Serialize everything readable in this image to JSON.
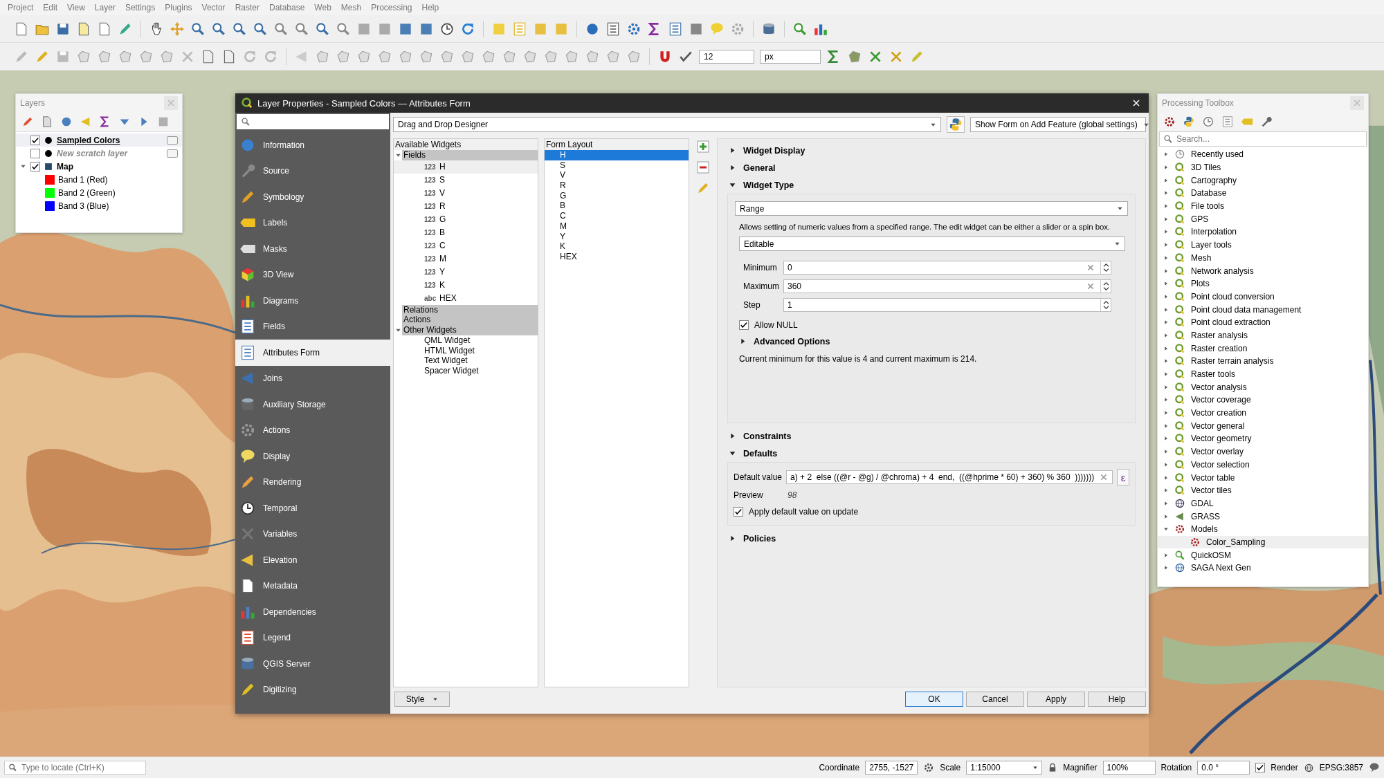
{
  "menu": [
    "Project",
    "Edit",
    "View",
    "Layer",
    "Settings",
    "Plugins",
    "Vector",
    "Raster",
    "Database",
    "Web",
    "Mesh",
    "Processing",
    "Help"
  ],
  "toolbar": {
    "size": "12",
    "unit": "px"
  },
  "layers_panel": {
    "title": "Layers",
    "layers": [
      {
        "name": "Sampled Colors",
        "kind": "vector",
        "checked": true,
        "selected": true
      },
      {
        "name": "New scratch layer",
        "kind": "scratch",
        "checked": false,
        "selected": false
      },
      {
        "name": "Map",
        "kind": "raster",
        "checked": true,
        "selected": false,
        "expanded": true,
        "children": [
          {
            "name": "Band 1 (Red)",
            "color": "#ff0000"
          },
          {
            "name": "Band 2 (Green)",
            "color": "#00ff00"
          },
          {
            "name": "Band 3 (Blue)",
            "color": "#0000ff"
          }
        ]
      }
    ]
  },
  "dialog": {
    "title": "Layer Properties - Sampled Colors — Attributes Form",
    "pages": [
      {
        "label": "Information",
        "selected": false
      },
      {
        "label": "Source",
        "selected": false
      },
      {
        "label": "Symbology",
        "selected": false
      },
      {
        "label": "Labels",
        "selected": false
      },
      {
        "label": "Masks",
        "selected": false
      },
      {
        "label": "3D View",
        "selected": false
      },
      {
        "label": "Diagrams",
        "selected": false
      },
      {
        "label": "Fields",
        "selected": false
      },
      {
        "label": "Attributes Form",
        "selected": true
      },
      {
        "label": "Joins",
        "selected": false
      },
      {
        "label": "Auxiliary Storage",
        "selected": false
      },
      {
        "label": "Actions",
        "selected": false
      },
      {
        "label": "Display",
        "selected": false
      },
      {
        "label": "Rendering",
        "selected": false
      },
      {
        "label": "Temporal",
        "selected": false
      },
      {
        "label": "Variables",
        "selected": false
      },
      {
        "label": "Elevation",
        "selected": false
      },
      {
        "label": "Metadata",
        "selected": false
      },
      {
        "label": "Dependencies",
        "selected": false
      },
      {
        "label": "Legend",
        "selected": false
      },
      {
        "label": "QGIS Server",
        "selected": false
      },
      {
        "label": "Digitizing",
        "selected": false
      }
    ],
    "designer": "Drag and Drop Designer",
    "form_mode": "Show Form on Add Feature (global settings)",
    "available": {
      "heading": "Available Widgets",
      "groups": [
        {
          "label": "Fields",
          "expanded": true,
          "children": [
            {
              "type": "123",
              "label": "H",
              "selected": true
            },
            {
              "type": "123",
              "label": "S",
              "selected": false
            },
            {
              "type": "123",
              "label": "V",
              "selected": false
            },
            {
              "type": "123",
              "label": "R",
              "selected": false
            },
            {
              "type": "123",
              "label": "G",
              "selected": false
            },
            {
              "type": "123",
              "label": "B",
              "selected": false
            },
            {
              "type": "123",
              "label": "C",
              "selected": false
            },
            {
              "type": "123",
              "label": "M",
              "selected": false
            },
            {
              "type": "123",
              "label": "Y",
              "selected": false
            },
            {
              "type": "123",
              "label": "K",
              "selected": false
            },
            {
              "type": "abc",
              "label": "HEX",
              "selected": false
            }
          ]
        },
        {
          "label": "Relations"
        },
        {
          "label": "Actions"
        },
        {
          "label": "Other Widgets",
          "expanded": true,
          "children": [
            {
              "label": "QML Widget"
            },
            {
              "label": "HTML Widget"
            },
            {
              "label": "Text Widget"
            },
            {
              "label": "Spacer Widget"
            }
          ]
        }
      ]
    },
    "form_layout": {
      "heading": "Form Layout",
      "items": [
        {
          "label": "H",
          "selected": true
        },
        {
          "label": "S",
          "selected": false
        },
        {
          "label": "V",
          "selected": false
        },
        {
          "label": "R",
          "selected": false
        },
        {
          "label": "G",
          "selected": false
        },
        {
          "label": "B",
          "selected": false
        },
        {
          "label": "C",
          "selected": false
        },
        {
          "label": "M",
          "selected": false
        },
        {
          "label": "Y",
          "selected": false
        },
        {
          "label": "K",
          "selected": false
        },
        {
          "label": "HEX",
          "selected": false
        }
      ]
    },
    "sections": [
      {
        "title": "Widget Display",
        "expanded": false
      },
      {
        "title": "General",
        "expanded": false
      },
      {
        "title": "Widget Type",
        "expanded": true,
        "kind": "widget_type",
        "widget": "Range",
        "description": "Allows setting of numeric values from a specified range. The edit widget can be either a slider or a spin box.",
        "mode": "Editable",
        "fields": [
          {
            "label": "Minimum",
            "value": "0",
            "clearable": true
          },
          {
            "label": "Maximum",
            "value": "360",
            "clearable": true
          },
          {
            "label": "Step",
            "value": "1",
            "clearable": false
          }
        ],
        "allow_null": {
          "label": "Allow NULL",
          "checked": true
        },
        "advanced": {
          "title": "Advanced Options",
          "expanded": false
        },
        "note": "Current minimum for this value is 4 and current maximum is 214."
      },
      {
        "title": "Constraints",
        "expanded": false
      },
      {
        "title": "Defaults",
        "expanded": true,
        "kind": "defaults",
        "label": "Default value",
        "value": "a) + 2  else ((@r - @g) / @chroma) + 4  end,  ((@hprime * 60) + 360) % 360  )))))))",
        "expression_button": "ε",
        "preview_label": "Preview",
        "preview": "98",
        "apply": {
          "label": "Apply default value on update",
          "checked": true
        }
      },
      {
        "title": "Policies",
        "expanded": false
      }
    ],
    "buttons": [
      {
        "label": "Style",
        "kind": "menu"
      },
      {
        "label": "OK",
        "kind": "default"
      },
      {
        "label": "Cancel",
        "kind": "normal"
      },
      {
        "label": "Apply",
        "kind": "normal"
      },
      {
        "label": "Help",
        "kind": "normal"
      }
    ]
  },
  "toolbox": {
    "title": "Processing Toolbox",
    "search_placeholder": "Search...",
    "items": [
      {
        "label": "Recently used",
        "kind": "history",
        "expanded": false
      },
      {
        "label": "3D Tiles",
        "kind": "qgis",
        "expanded": false
      },
      {
        "label": "Cartography",
        "kind": "qgis",
        "expanded": false
      },
      {
        "label": "Database",
        "kind": "qgis",
        "expanded": false
      },
      {
        "label": "File tools",
        "kind": "qgis",
        "expanded": false
      },
      {
        "label": "GPS",
        "kind": "qgis",
        "expanded": false
      },
      {
        "label": "Interpolation",
        "kind": "qgis",
        "expanded": false
      },
      {
        "label": "Layer tools",
        "kind": "qgis",
        "expanded": false
      },
      {
        "label": "Mesh",
        "kind": "qgis",
        "expanded": false
      },
      {
        "label": "Network analysis",
        "kind": "qgis",
        "expanded": false
      },
      {
        "label": "Plots",
        "kind": "qgis",
        "expanded": false
      },
      {
        "label": "Point cloud conversion",
        "kind": "qgis",
        "expanded": false
      },
      {
        "label": "Point cloud data management",
        "kind": "qgis",
        "expanded": false
      },
      {
        "label": "Point cloud extraction",
        "kind": "qgis",
        "expanded": false
      },
      {
        "label": "Raster analysis",
        "kind": "qgis",
        "expanded": false
      },
      {
        "label": "Raster creation",
        "kind": "qgis",
        "expanded": false
      },
      {
        "label": "Raster terrain analysis",
        "kind": "qgis",
        "expanded": false
      },
      {
        "label": "Raster tools",
        "kind": "qgis",
        "expanded": false
      },
      {
        "label": "Vector analysis",
        "kind": "qgis",
        "expanded": false
      },
      {
        "label": "Vector coverage",
        "kind": "qgis",
        "expanded": false
      },
      {
        "label": "Vector creation",
        "kind": "qgis",
        "expanded": false
      },
      {
        "label": "Vector general",
        "kind": "qgis",
        "expanded": false
      },
      {
        "label": "Vector geometry",
        "kind": "qgis",
        "expanded": false
      },
      {
        "label": "Vector overlay",
        "kind": "qgis",
        "expanded": false
      },
      {
        "label": "Vector selection",
        "kind": "qgis",
        "expanded": false
      },
      {
        "label": "Vector table",
        "kind": "qgis",
        "expanded": false
      },
      {
        "label": "Vector tiles",
        "kind": "qgis",
        "expanded": false
      },
      {
        "label": "GDAL",
        "kind": "gdal",
        "expanded": false
      },
      {
        "label": "GRASS",
        "kind": "grass",
        "expanded": false
      },
      {
        "label": "Models",
        "kind": "models",
        "expanded": true,
        "children": [
          {
            "label": "Color_Sampling",
            "selected": true
          }
        ]
      },
      {
        "label": "QuickOSM",
        "kind": "quickosm",
        "expanded": false
      },
      {
        "label": "SAGA Next Gen",
        "kind": "saga",
        "expanded": false
      }
    ]
  },
  "status_bar": {
    "locator_placeholder": "Type to locate (Ctrl+K)",
    "coordinate_label": "Coordinate",
    "coordinate": "2755, -1527",
    "scale_label": "Scale",
    "scale": "1:15000",
    "magnifier_label": "Magnifier",
    "magnifier": "100%",
    "rotation_label": "Rotation",
    "rotation": "0.0 °",
    "render": {
      "label": "Render",
      "checked": true
    },
    "crs": "EPSG:3857"
  }
}
